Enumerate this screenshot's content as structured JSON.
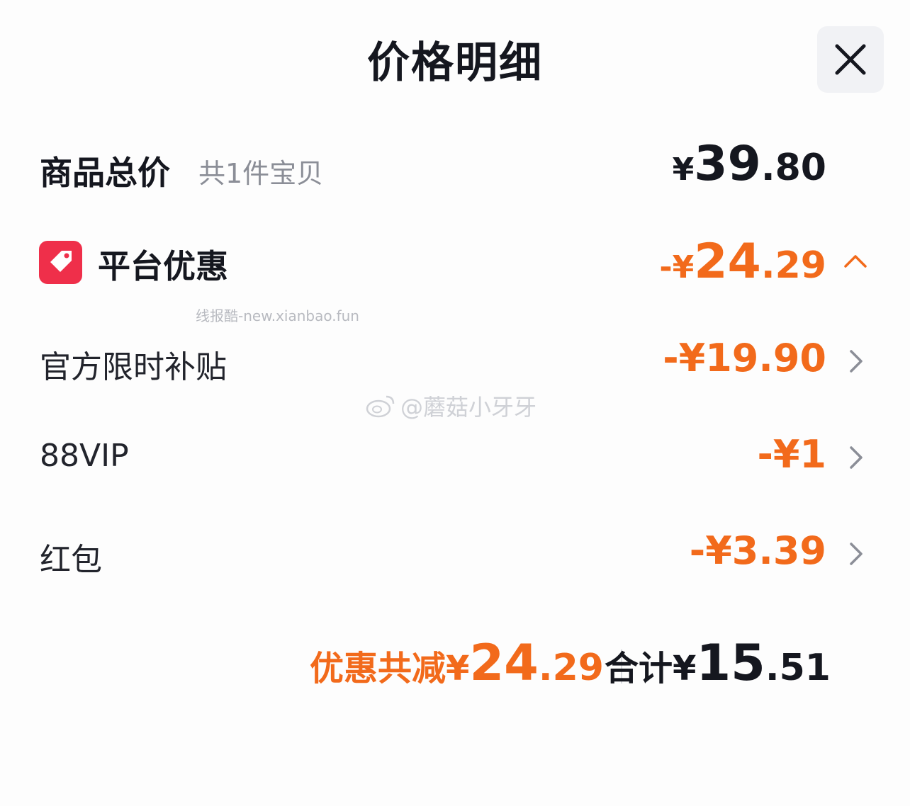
{
  "header": {
    "title": "价格明细",
    "close_icon": "close-icon"
  },
  "goods_total": {
    "label": "商品总价",
    "count_text": "共1件宝贝",
    "price": {
      "currency": "¥",
      "int": "39",
      "dec": ".80"
    }
  },
  "platform_discount": {
    "icon": "tag-icon",
    "icon_color": "#ef2f4a",
    "label": "平台优惠",
    "amount": {
      "sign": "-",
      "currency": "¥",
      "int": "24",
      "dec": ".29"
    },
    "expand_icon": "chevron-up-icon"
  },
  "discount_items": [
    {
      "label": "官方限时补贴",
      "amount": "-¥19.90"
    },
    {
      "label": "88VIP",
      "amount": "-¥1"
    },
    {
      "label": "红包",
      "amount": "-¥3.39"
    }
  ],
  "footer": {
    "saved_label": "优惠共减¥",
    "saved_int": "24",
    "saved_dec": ".29",
    "total_label": "合计¥",
    "total_int": "15",
    "total_dec": ".51"
  },
  "watermarks": {
    "site": "线报酷-new.xianbao.fun",
    "weibo": "@蘑菇小牙牙"
  },
  "colors": {
    "accent": "#f26a1b",
    "text": "#15171f",
    "muted": "#8b8e97"
  }
}
